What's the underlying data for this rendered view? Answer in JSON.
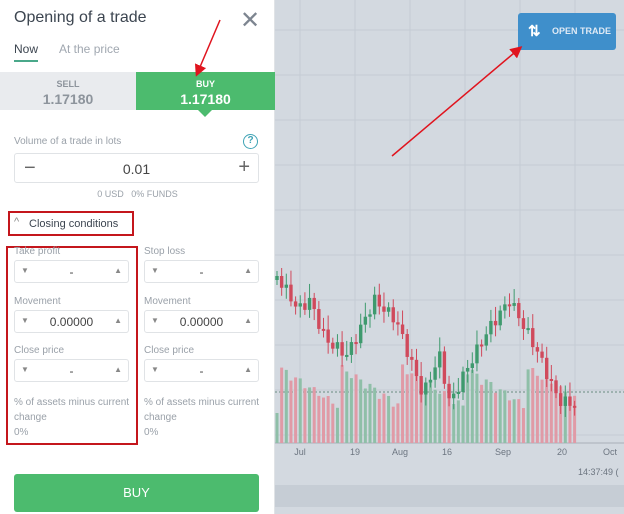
{
  "panel": {
    "title": "Opening of a trade",
    "tabs": [
      "Now",
      "At the price"
    ],
    "sell": {
      "label": "SELL",
      "price": "1.17180"
    },
    "buy": {
      "label": "BUY",
      "price": "1.17180"
    },
    "volume_label": "Volume of a trade in lots",
    "volume_value": "0.01",
    "funds_info": "0 USD   0% FUNDS",
    "closing_conditions": "Closing conditions",
    "take_profit": {
      "label": "Take profit",
      "value": "-",
      "movement_label": "Movement",
      "movement": "0.00000",
      "close_label": "Close price",
      "close": "-",
      "pct_label": "% of assets minus current change",
      "pct": "0%"
    },
    "stop_loss": {
      "label": "Stop loss",
      "value": "-",
      "movement_label": "Movement",
      "movement": "0.00000",
      "close_label": "Close price",
      "close": "-",
      "pct_label": "% of assets minus current change",
      "pct": "0%"
    },
    "buy_button": "BUY"
  },
  "chart": {
    "open_trade": "OPEN TRADE",
    "x_ticks": [
      "Jul",
      "19",
      "Aug",
      "16",
      "Sep",
      "20",
      "Oct"
    ],
    "time": "14:37:49 (",
    "colors": {
      "up": "#3f9a6e",
      "down": "#d04a5c",
      "buy": "#4cbb6e",
      "open_trade": "#3f8fcb",
      "annotation": "#e0141e"
    }
  }
}
